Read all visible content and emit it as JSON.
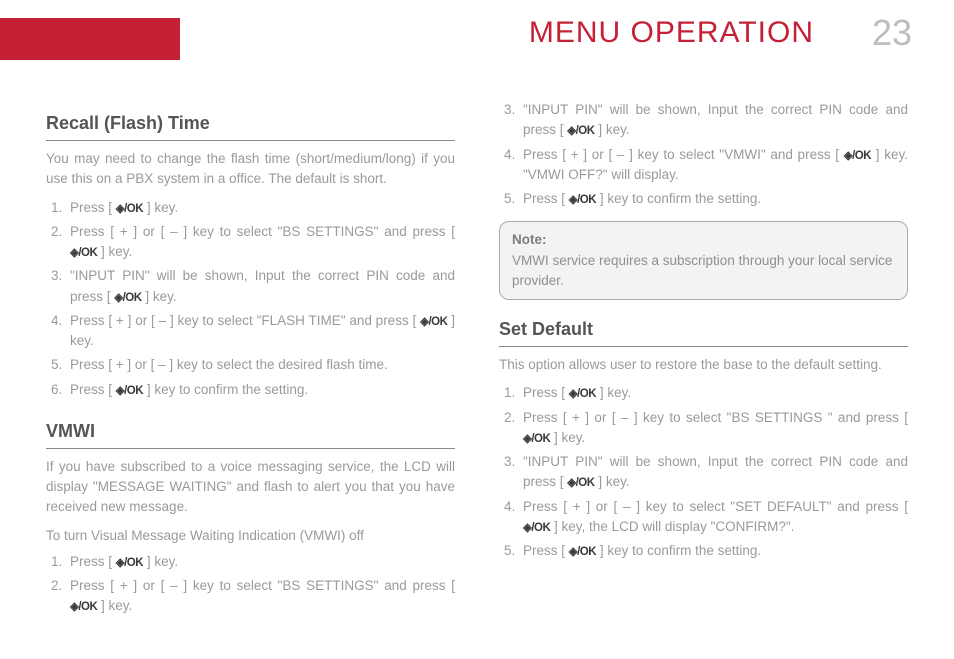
{
  "header": {
    "title": "MENU OPERATION",
    "pageNumber": "23"
  },
  "left": {
    "recall": {
      "heading": "Recall (Flash) Time",
      "intro": "You may need to change the flash time (short/medium/long) if you use this on a PBX system in a office. The default is short.",
      "steps": [
        {
          "pre": "Press [ ",
          "icon": true,
          "post": " ] key."
        },
        {
          "pre": "Press [ + ] or [ – ] key to select \"BS SETTINGS\" and press [ ",
          "icon": true,
          "post": " ] key."
        },
        {
          "pre": "\"INPUT PIN\" will be shown, Input the correct PIN code and press [ ",
          "icon": true,
          "post": " ] key."
        },
        {
          "pre": "Press [ + ] or [ – ] key to select \"FLASH TIME\" and press [ ",
          "icon": true,
          "post": " ] key."
        },
        {
          "pre": "Press [ + ] or [ – ] key to select the desired flash time.",
          "icon": false,
          "post": ""
        },
        {
          "pre": "Press [ ",
          "icon": true,
          "post": " ] key to confirm the setting."
        }
      ]
    },
    "vmwi": {
      "heading": "VMWI",
      "intro": "If you have subscribed to a voice messaging service, the LCD will display \"MESSAGE WAITING\" and flash to alert you that you have received new message.",
      "sub": "To turn Visual Message Waiting Indication (VMWI) off",
      "steps": [
        {
          "pre": "Press [ ",
          "icon": true,
          "post": " ] key."
        },
        {
          "pre": "Press [ + ] or [ – ] key to select \"BS SETTINGS\" and press [ ",
          "icon": true,
          "post": " ] key."
        }
      ]
    }
  },
  "right": {
    "vmwiCont": {
      "startIndex": 3,
      "steps": [
        {
          "pre": "\"INPUT PIN\" will be shown, Input the correct PIN code and press [ ",
          "icon": true,
          "post": " ] key."
        },
        {
          "pre": "Press [ + ] or [ – ] key to select \"VMWI\" and press [ ",
          "icon": true,
          "post": " ] key. \"VMWI OFF?\" will display."
        },
        {
          "pre": "Press [ ",
          "icon": true,
          "post": " ] key to confirm the setting."
        }
      ]
    },
    "note": {
      "label": "Note:",
      "body": "VMWI service requires a subscription through your local service provider."
    },
    "setDefault": {
      "heading": "Set Default",
      "intro": "This option allows user to restore the base to the default setting.",
      "steps": [
        {
          "pre": "Press [ ",
          "icon": true,
          "post": " ] key."
        },
        {
          "pre": "Press [ + ] or [ – ] key to select \"BS SETTINGS \" and press [ ",
          "icon": true,
          "post": " ] key."
        },
        {
          "pre": "\"INPUT PIN\" will be shown, Input the correct PIN code and press [ ",
          "icon": true,
          "post": " ] key."
        },
        {
          "pre": "Press [ + ] or [ – ] key to select \"SET DEFAULT\" and press [ ",
          "icon": true,
          "post": " ] key, the LCD will display \"CONFIRM?\"."
        },
        {
          "pre": "Press [ ",
          "icon": true,
          "post": " ] key to confirm the setting."
        }
      ]
    }
  }
}
